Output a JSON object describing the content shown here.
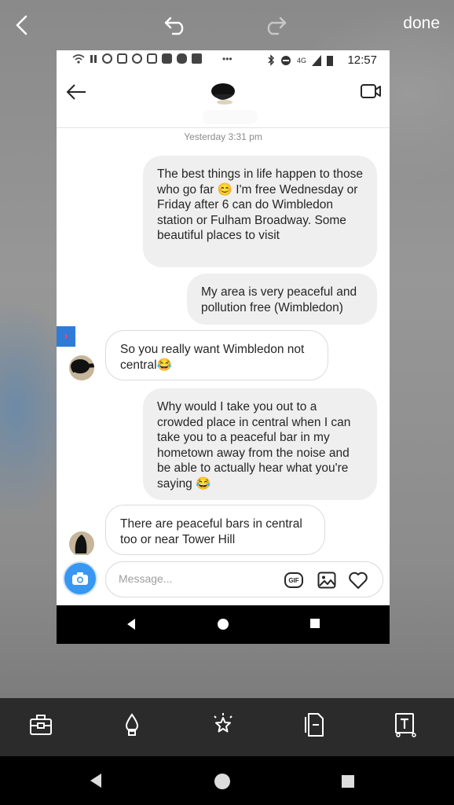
{
  "editor": {
    "back_icon": "chevron-left-icon",
    "undo_icon": "undo-icon",
    "redo_icon": "redo-icon",
    "done_label": "done",
    "tools": [
      "briefcase-icon",
      "drop-icon",
      "sparkle-icon",
      "document-icon",
      "text-icon"
    ]
  },
  "status_bar": {
    "time": "12:57",
    "network": "4G"
  },
  "chat": {
    "timestamp": "Yesterday 3:31 pm",
    "messages": [
      {
        "from": "me",
        "text": "The best things in life happen to those who go far 😊 I'm free Wednesday or Friday after 6 can do Wimbledon station or Fulham Broadway. Some beautiful places to visit"
      },
      {
        "from": "me",
        "text": "My area is very peaceful and pollution free  (Wimbledon)"
      },
      {
        "from": "them",
        "text": "So you really want Wimbledon not central😂"
      },
      {
        "from": "me",
        "text": "Why would I take you out to a crowded place in central when I can take you to a peaceful bar in my hometown away from the noise and be able to actually hear what you're saying 😂"
      },
      {
        "from": "them",
        "text": "There are peaceful bars in central too or near Tower Hill"
      }
    ]
  },
  "composer": {
    "placeholder": "Message...",
    "gif_label": "GIF"
  },
  "colors": {
    "accent": "#3897f0",
    "bubble_me": "#efefef",
    "toolbar": "#2b2b2b"
  }
}
